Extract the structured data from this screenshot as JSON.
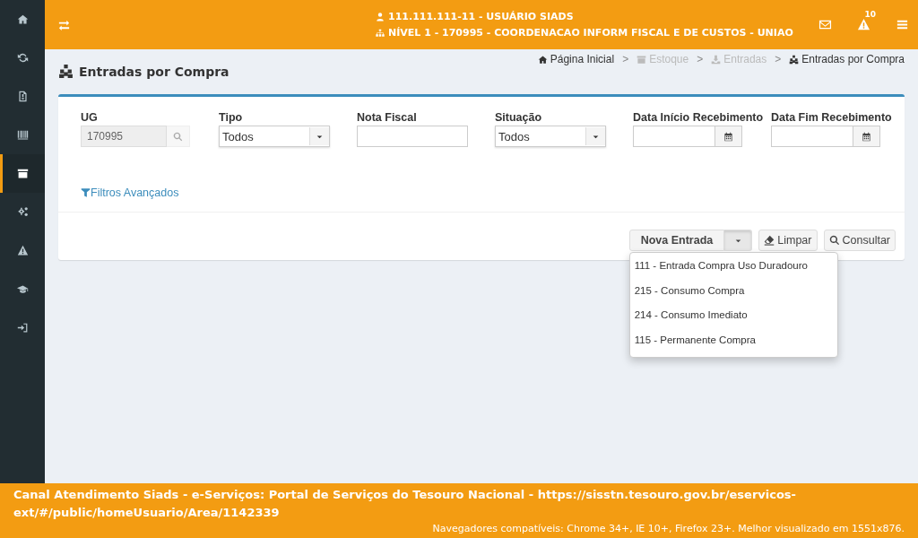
{
  "sidebar": {
    "items": [
      {
        "selected": false
      },
      {
        "selected": false
      },
      {
        "selected": false
      },
      {
        "selected": false
      },
      {
        "selected": true
      },
      {
        "selected": false
      },
      {
        "selected": false
      },
      {
        "selected": false
      },
      {
        "selected": false
      }
    ]
  },
  "header": {
    "user": "111.111.111-11 - USUÁRIO SIADS",
    "unit": "NÍVEL 1 - 170995 - COORDENACAO INFORM FISCAL E DE CUSTOS - UNIAO",
    "alert_count": "10"
  },
  "page": {
    "title": "Entradas por Compra"
  },
  "breadcrumb": [
    {
      "label": "Página Inicial",
      "disabled": false
    },
    {
      "label": "Estoque",
      "disabled": true
    },
    {
      "label": "Entradas",
      "disabled": true
    },
    {
      "label": "Entradas por Compra",
      "disabled": false
    }
  ],
  "breadcrumb_separator": ">",
  "filters": [
    {
      "kind": "lookup",
      "label": "UG",
      "value": "170995",
      "disabled": true
    },
    {
      "kind": "select",
      "label": "Tipo",
      "value": "Todos"
    },
    {
      "kind": "text",
      "label": "Nota Fiscal"
    },
    {
      "kind": "select",
      "label": "Situação",
      "value": "Todos"
    },
    {
      "kind": "date",
      "label": "Data Início Recebimento"
    },
    {
      "kind": "date",
      "label": "Data Fim Recebimento"
    }
  ],
  "advanced_filters": "Filtros Avançados",
  "actions": {
    "new_entry": "Nova Entrada",
    "expanded": true,
    "clear": "Limpar",
    "search": "Consultar"
  },
  "menu": [
    "111 - Entrada Compra Uso Duradouro",
    "215 - Consumo Compra",
    "214 - Consumo Imediato",
    "115 - Permanente Compra"
  ],
  "footer": {
    "channel": "Canal Atendimento Siads - e-Serviços: Portal de Serviços do Tesouro Nacional - https://sisstn.tesouro.gov.br/eservicos-ext/#/public/homeUsuario/Area/1142339",
    "browsers": "Navegadores compatíveis: Chrome 34+, IE 10+, Firefox 23+. Melhor visualizado em 1551x876."
  }
}
